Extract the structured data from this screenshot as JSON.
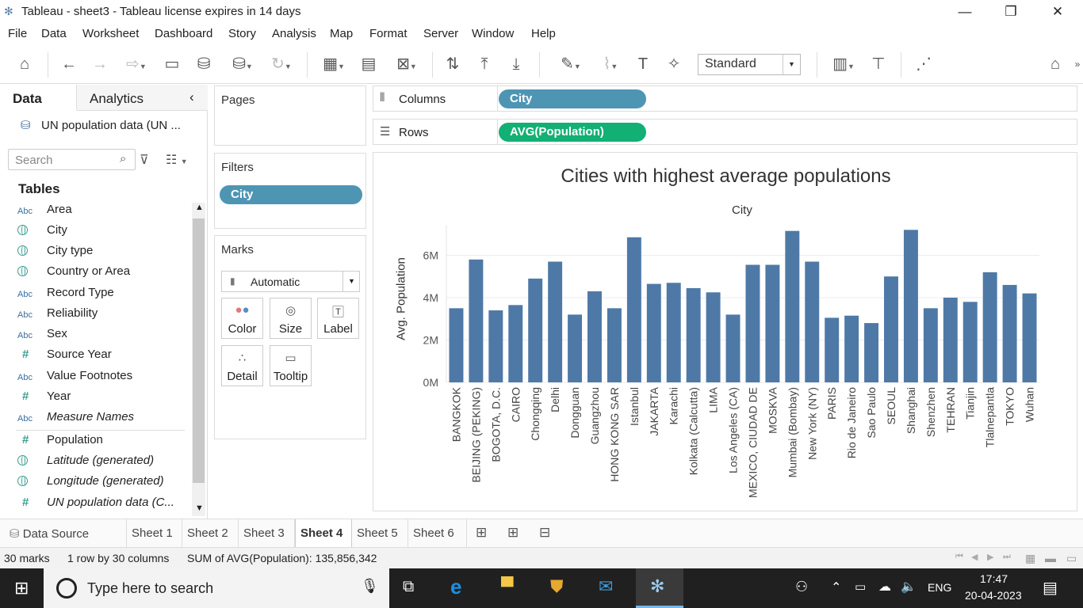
{
  "window": {
    "title": "Tableau - sheet3 - Tableau license expires in 14 days",
    "minimize": "—",
    "restore": "❐",
    "close": "✕"
  },
  "menu": [
    "File",
    "Data",
    "Worksheet",
    "Dashboard",
    "Story",
    "Analysis",
    "Map",
    "Format",
    "Server",
    "Window",
    "Help"
  ],
  "toolbar": {
    "fit_select": "Standard"
  },
  "datapane": {
    "tab_data": "Data",
    "tab_analytics": "Analytics",
    "datasource": "UN population data (UN ...",
    "search_placeholder": "Search",
    "tables_heading": "Tables",
    "fields": [
      {
        "type": "Abc",
        "name": "Area"
      },
      {
        "type": "globe",
        "name": "City"
      },
      {
        "type": "globe",
        "name": "City type"
      },
      {
        "type": "globe",
        "name": "Country or Area"
      },
      {
        "type": "Abc",
        "name": "Record Type"
      },
      {
        "type": "Abc",
        "name": "Reliability"
      },
      {
        "type": "Abc",
        "name": "Sex"
      },
      {
        "type": "#",
        "name": "Source Year"
      },
      {
        "type": "Abc",
        "name": "Value Footnotes"
      },
      {
        "type": "#",
        "name": "Year"
      },
      {
        "type": "Abc",
        "name": "Measure Names"
      },
      {
        "type": "#",
        "name": "Population"
      },
      {
        "type": "globe",
        "name": "Latitude (generated)"
      },
      {
        "type": "globe",
        "name": "Longitude (generated)"
      },
      {
        "type": "#",
        "name": "UN population data (C..."
      }
    ]
  },
  "cards": {
    "pages": "Pages",
    "filters": "Filters",
    "filter_pill": "City",
    "marks": "Marks",
    "mark_type": "Automatic",
    "mark_buttons": [
      "Color",
      "Size",
      "Label",
      "Detail",
      "Tooltip"
    ]
  },
  "shelves": {
    "columns_label": "Columns",
    "columns_pill": "City",
    "rows_label": "Rows",
    "rows_pill": "AVG(Population)"
  },
  "chart_data": {
    "type": "bar",
    "title": "Cities with highest average populations",
    "x_header": "City",
    "ylabel": "Avg. Population",
    "yticks": [
      "0M",
      "2M",
      "4M",
      "6M"
    ],
    "ylim": [
      0,
      7400000
    ],
    "bar_color": "#4e79a7",
    "categories": [
      "BANGKOK",
      "BEIJING (PEKING)",
      "BOGOTA, D.C.",
      "CAIRO",
      "Chongqing",
      "Delhi",
      "Dongguan",
      "Guangzhou",
      "HONG KONG SAR",
      "Istanbul",
      "JAKARTA",
      "Karachi",
      "Kolkata (Calcutta)",
      "LIMA",
      "Los Angeles (CA)",
      "MEXICO, CIUDAD DE",
      "MOSKVA",
      "Mumbai (Bombay)",
      "New York (NY)",
      "PARIS",
      "Rio de Janeiro",
      "Sao Paulo",
      "SEOUL",
      "Shanghai",
      "Shenzhen",
      "TEHRAN",
      "Tianjin",
      "Tlalnepantla",
      "TOKYO",
      "Wuhan"
    ],
    "values": [
      3500000,
      5800000,
      3400000,
      3650000,
      4900000,
      5700000,
      3200000,
      4300000,
      3500000,
      6850000,
      4650000,
      4700000,
      4450000,
      4250000,
      3200000,
      5550000,
      5550000,
      7150000,
      5700000,
      3050000,
      3150000,
      2800000,
      5000000,
      7200000,
      3500000,
      4000000,
      3800000,
      5200000,
      4600000,
      4200000
    ]
  },
  "sheet_tabs": {
    "data_source": "Data Source",
    "sheets": [
      "Sheet 1",
      "Sheet 2",
      "Sheet 3",
      "Sheet 4",
      "Sheet 5",
      "Sheet 6"
    ],
    "active": "Sheet 4"
  },
  "status": {
    "marks": "30 marks",
    "dims": "1 row by 30 columns",
    "sum": "SUM of AVG(Population): 135,856,342"
  },
  "taskbar": {
    "search_placeholder": "Type here to search",
    "language": "ENG",
    "time": "17:47",
    "date": "20-04-2023"
  }
}
